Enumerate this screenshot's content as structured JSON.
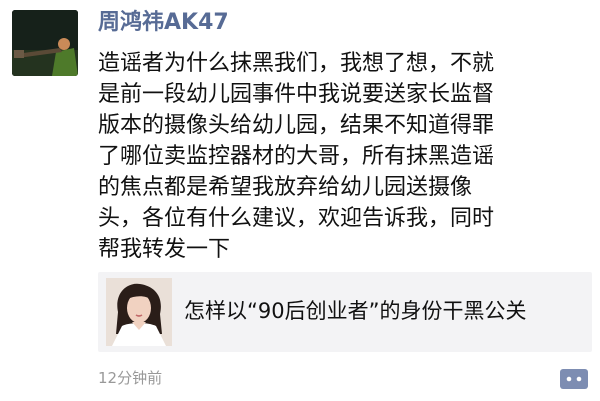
{
  "post": {
    "author": "周鸿祎AK47",
    "content_lines": [
      "造谣者为什么抹黑我们，我想了想，不就",
      "是前一段幼儿园事件中我说要送家长监督",
      "版本的摄像头给幼儿园，结果不知道得罪",
      "了哪位卖监控器材的大哥，所有抹黑造谣",
      "的焦点都是希望我放弃给幼儿园送摄像",
      "头，各位有什么建议，欢迎告诉我，同时",
      "帮我转发一下"
    ],
    "shared_link": {
      "title": "怎样以“90后创业者”的身份干黑公关"
    },
    "timestamp": "12分钟前"
  },
  "icons": {
    "avatar": "avatar-photo",
    "thumbnail": "article-thumbnail",
    "comment": "comment-dots-icon"
  },
  "colors": {
    "author_name": "#576b95",
    "card_background": "#f3f3f5",
    "timestamp": "#999999",
    "comment_button": "#7d8db2"
  }
}
